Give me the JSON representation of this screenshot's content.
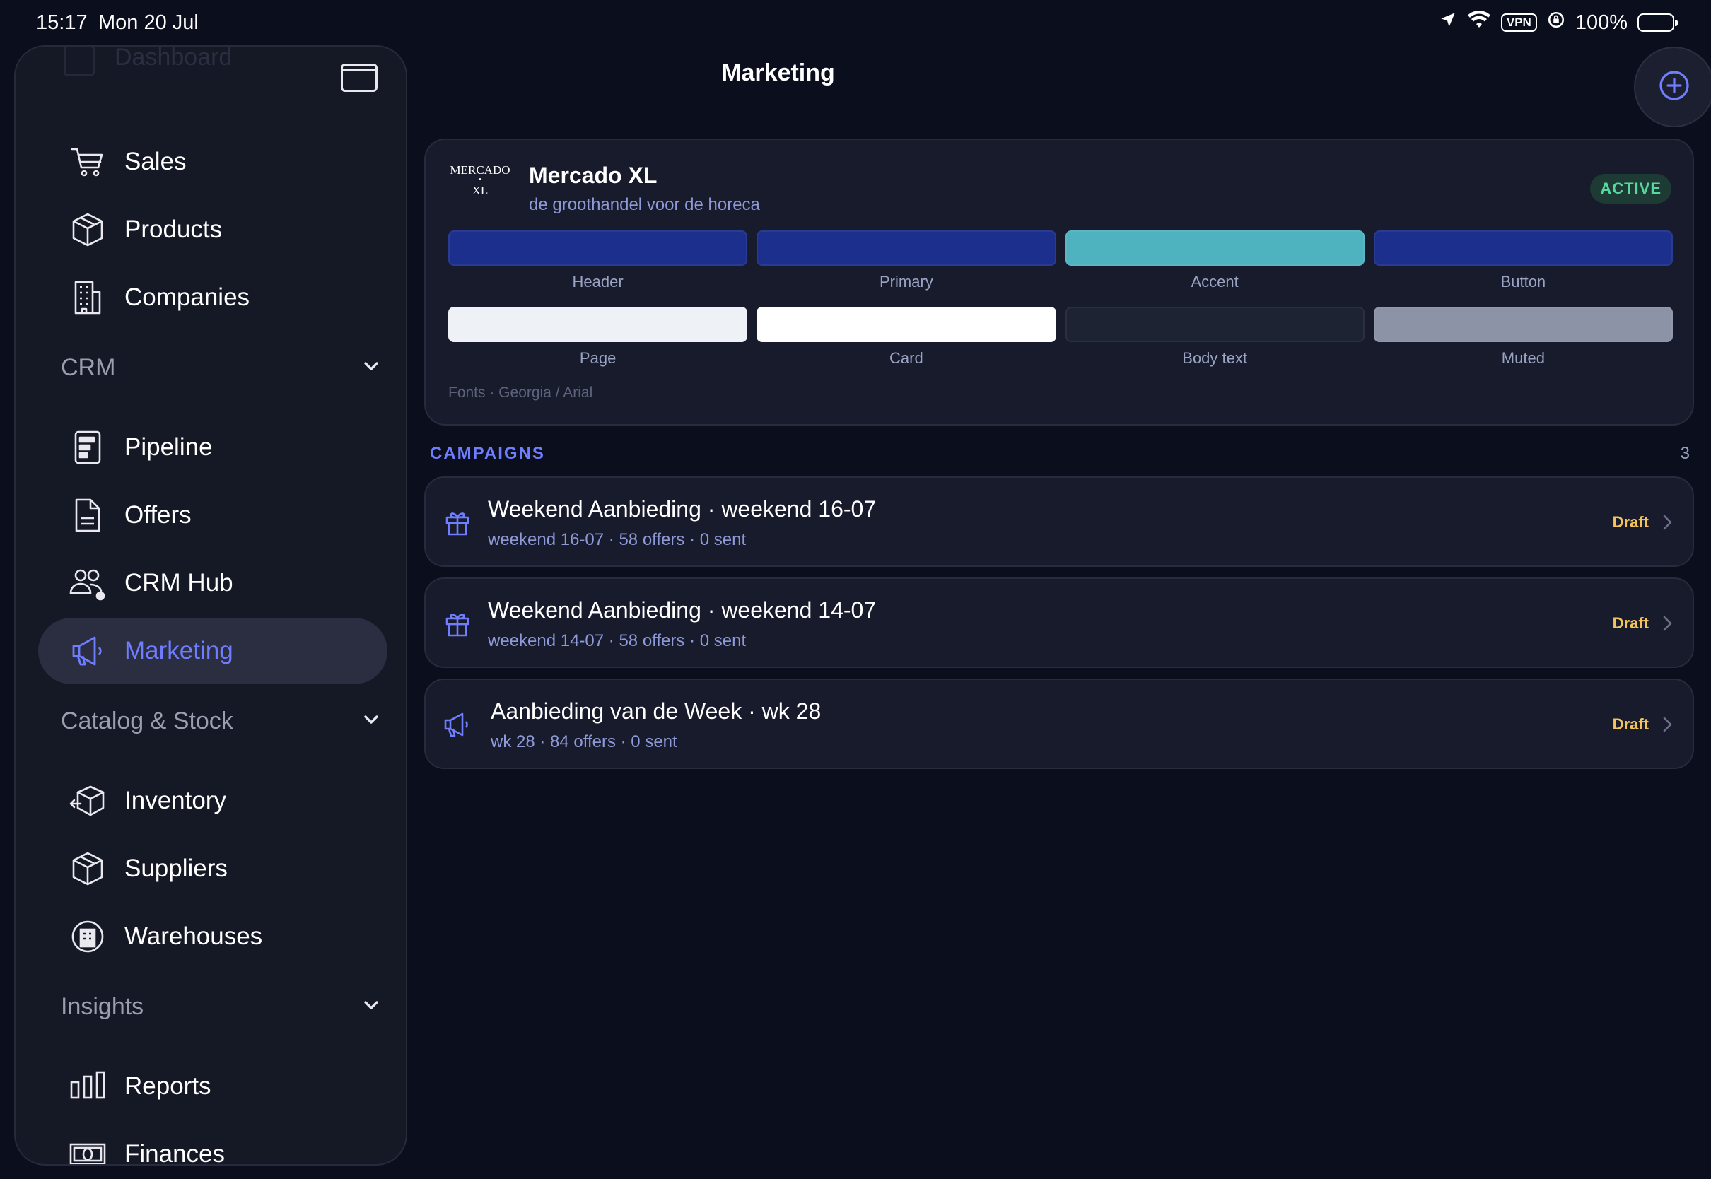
{
  "status_bar": {
    "time": "15:17",
    "date": "Mon 20 Jul",
    "vpn": "VPN",
    "battery": "100%"
  },
  "sidebar": {
    "ghost_item": "Dashboard",
    "items_top": [
      {
        "label": "Sales",
        "icon": "cart-icon"
      },
      {
        "label": "Products",
        "icon": "box-icon"
      },
      {
        "label": "Companies",
        "icon": "building-icon"
      }
    ],
    "sections": [
      {
        "title": "CRM",
        "items": [
          {
            "label": "Pipeline",
            "icon": "pipeline-icon"
          },
          {
            "label": "Offers",
            "icon": "document-icon"
          },
          {
            "label": "CRM Hub",
            "icon": "people-gear-icon"
          },
          {
            "label": "Marketing",
            "icon": "megaphone-icon",
            "active": true
          }
        ]
      },
      {
        "title": "Catalog & Stock",
        "items": [
          {
            "label": "Inventory",
            "icon": "box-arrow-icon"
          },
          {
            "label": "Suppliers",
            "icon": "box-icon"
          },
          {
            "label": "Warehouses",
            "icon": "warehouse-icon"
          }
        ]
      },
      {
        "title": "Insights",
        "items": [
          {
            "label": "Reports",
            "icon": "bar-chart-icon"
          },
          {
            "label": "Finances",
            "icon": "banknote-icon"
          }
        ]
      }
    ]
  },
  "header": {
    "title": "Marketing"
  },
  "brand": {
    "logo_line1": "MERCADO",
    "logo_line2": "XL",
    "name": "Mercado XL",
    "tagline": "de groothandel voor de horeca",
    "status": "ACTIVE",
    "swatches": [
      {
        "name": "Header",
        "color": "#1c2f8c"
      },
      {
        "name": "Primary",
        "color": "#1c2f8c"
      },
      {
        "name": "Accent",
        "color": "#4fb2bf"
      },
      {
        "name": "Button",
        "color": "#1c2f8c"
      },
      {
        "name": "Page",
        "color": "#eef1f6"
      },
      {
        "name": "Card",
        "color": "#ffffff"
      },
      {
        "name": "Body text",
        "color": "#1e2333"
      },
      {
        "name": "Muted",
        "color": "#8c93a6"
      }
    ],
    "fonts": "Fonts · Georgia / Arial"
  },
  "campaigns": {
    "heading": "CAMPAIGNS",
    "count": "3",
    "items": [
      {
        "title": "Weekend Aanbieding · weekend 16-07",
        "subtitle": "weekend 16-07 · 58 offers · 0 sent",
        "status": "Draft",
        "icon": "gift-icon"
      },
      {
        "title": "Weekend Aanbieding · weekend 14-07",
        "subtitle": "weekend 14-07 · 58 offers · 0 sent",
        "status": "Draft",
        "icon": "gift-icon"
      },
      {
        "title": "Aanbieding van de Week · wk 28",
        "subtitle": "wk 28 · 84 offers · 0 sent",
        "status": "Draft",
        "icon": "megaphone-icon"
      }
    ]
  },
  "colors": {
    "accent": "#6f7dff",
    "draft": "#f2c45a",
    "active_text": "#56d8a0"
  }
}
